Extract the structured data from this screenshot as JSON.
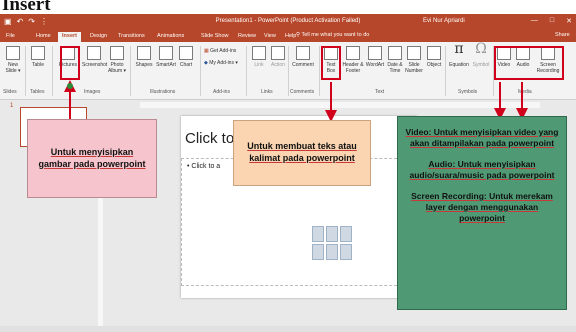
{
  "heading": "Insert",
  "titlebar": {
    "qat": [
      "▣",
      "↶",
      "↷",
      "⋮"
    ],
    "doc_title": "Presentation1 - PowerPoint (Product Activation Failed)",
    "user": "Evi Nur Apriardi",
    "window_buttons": [
      "—",
      "□",
      "✕"
    ]
  },
  "tabs": [
    "File",
    "Home",
    "Insert",
    "Design",
    "Transitions",
    "Animations",
    "Slide Show",
    "Review",
    "View",
    "Help"
  ],
  "active_tab": "Insert",
  "tell_me": "Tell me what you want to do",
  "share": "Share",
  "ribbon": {
    "buttons": [
      {
        "label": "New Slide ▾"
      },
      {
        "label": "Table"
      },
      {
        "label": "Pictures"
      },
      {
        "label": "Screenshot"
      },
      {
        "label": "Photo Album ▾"
      },
      {
        "label": "Shapes"
      },
      {
        "label": "SmartArt"
      },
      {
        "label": "Chart"
      },
      {
        "label": "Get Add-ins"
      },
      {
        "label": "My Add-ins ▾"
      },
      {
        "label": "Link"
      },
      {
        "label": "Action"
      },
      {
        "label": "Comment"
      },
      {
        "label": "Text Box"
      },
      {
        "label": "Header & Footer"
      },
      {
        "label": "WordArt"
      },
      {
        "label": "Date & Time"
      },
      {
        "label": "Slide Number"
      },
      {
        "label": "Object"
      },
      {
        "label": "Equation"
      },
      {
        "label": "Symbol"
      },
      {
        "label": "Video"
      },
      {
        "label": "Audio"
      },
      {
        "label": "Screen Recording"
      }
    ],
    "groups": [
      "Slides",
      "Tables",
      "Images",
      "Illustrations",
      "Add-ins",
      "Links",
      "Comments",
      "Text",
      "Symbols",
      "Media"
    ]
  },
  "thumbnail": {
    "number": "1"
  },
  "slide": {
    "title_placeholder": "Click to a",
    "content_placeholder": "• Click to a"
  },
  "callouts": {
    "pictures": "Untuk menyisipkan gambar pada powerpoint",
    "textbox": "Untuk membuat teks atau kalimat pada powerpoint",
    "media": [
      "Video: Untuk menyisipkan video yang akan ditampilakan pada powerpoint",
      "Audio: Untuk menyisipkan audio/suara/music pada powerpoint",
      "Screen Recording: Untuk merekam layer dengan menggunakan powerpoint"
    ]
  },
  "colors": {
    "brand": "#b7472a",
    "highlight": "#d0021b",
    "callout_pink": "#f6c4cc",
    "callout_peach": "#fbd5b1",
    "callout_green": "#4f9a74"
  }
}
